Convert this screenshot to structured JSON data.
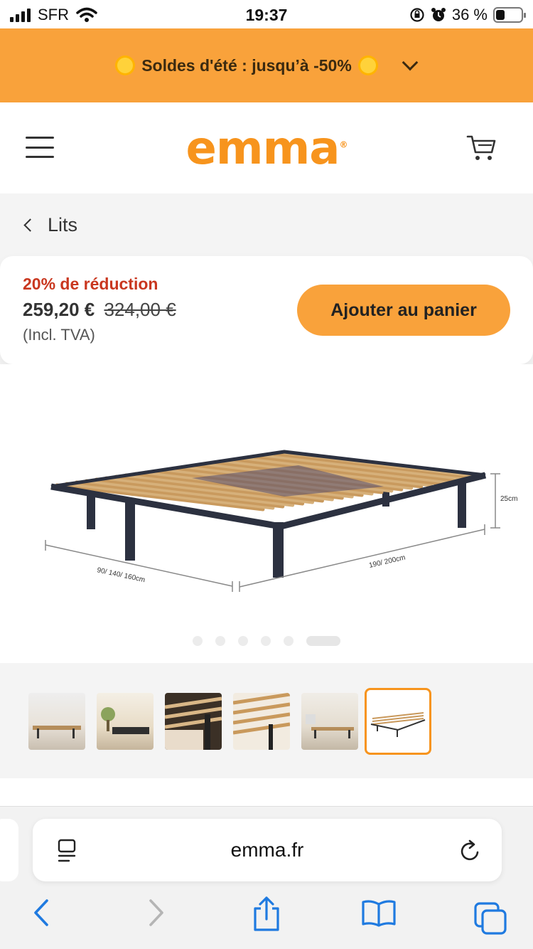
{
  "status": {
    "carrier": "SFR",
    "time": "19:37",
    "battery_text": "36 %",
    "battery_level": 0.36
  },
  "promo": {
    "text": "Soldes d'été : jusqu’à -50%"
  },
  "header": {
    "logo": "emma",
    "logo_mark": "®"
  },
  "breadcrumb": {
    "label": "Lits"
  },
  "price_card": {
    "discount": "20% de réduction",
    "price": "259,20 €",
    "old_price": "324,00 €",
    "vat": "(Incl. TVA)",
    "add_to_cart": "Ajouter au panier"
  },
  "gallery": {
    "dim_height": "25cm",
    "dim_length": "190/ 200cm",
    "dim_width": "90/ 140/ 160cm",
    "slide_count": 6,
    "active_slide": 6
  },
  "safari": {
    "url": "emma.fr"
  },
  "colors": {
    "accent": "#f9a23b",
    "brand": "#f7941d",
    "discount": "#c9371f",
    "safari_blue": "#1f7ae0"
  }
}
